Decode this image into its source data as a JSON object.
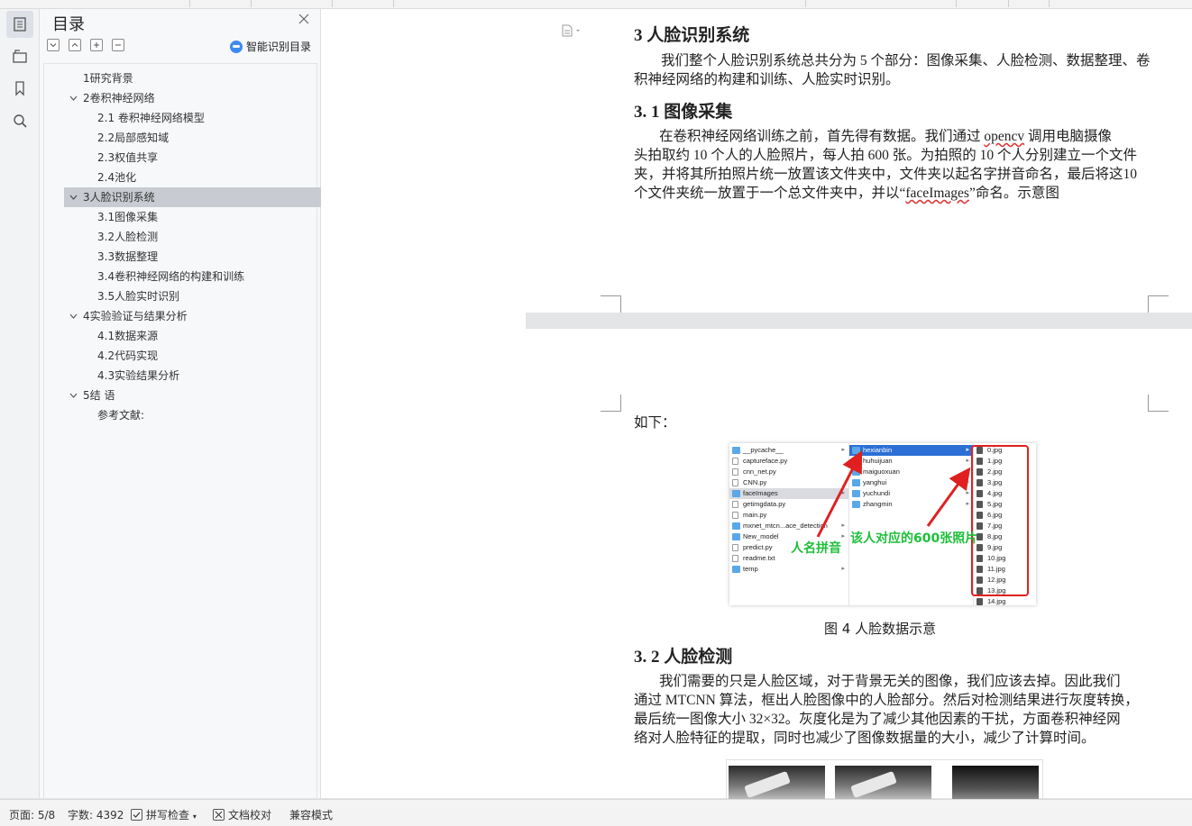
{
  "toc": {
    "title": "目录",
    "ai_button_label": "智能识别目录",
    "items": [
      {
        "label": "1研究背景"
      },
      {
        "label": "2卷积神经网络"
      },
      {
        "label": "2.1 卷积神经网络模型"
      },
      {
        "label": "2.2局部感知域"
      },
      {
        "label": "2.3权值共享"
      },
      {
        "label": "2.4池化"
      },
      {
        "label": "3人脸识别系统"
      },
      {
        "label": "3.1图像采集"
      },
      {
        "label": "3.2人脸检测"
      },
      {
        "label": "3.3数据整理"
      },
      {
        "label": "3.4卷积神经网络的构建和训练"
      },
      {
        "label": "3.5人脸实时识别"
      },
      {
        "label": "4实验验证与结果分析"
      },
      {
        "label": "4.1数据来源"
      },
      {
        "label": "4.2代码实现"
      },
      {
        "label": "4.3实验结果分析"
      },
      {
        "label": "5结  语"
      },
      {
        "label": "参考文献:"
      }
    ]
  },
  "document": {
    "h_3": "3  人脸识别系统",
    "p_3": [
      "我们整个人脸识别系统总共分为 5 个部分：图像采集、人脸检测、数据整理、卷",
      "积神经网络的构建和训练、人脸实时识别。"
    ],
    "h_31": "3. 1  图像采集",
    "p_31": {
      "l1a": "在卷积神经网络训练之前，首先得有数据。我们通过 ",
      "l1b": "opencv",
      "l1c": " 调用电脑摄像",
      "l2": "头拍取约 10 个人的人脸照片，每人拍 600 张。为拍照的 10 个人分别建立一个文件",
      "l3": "夹，并将其所拍照片统一放置该文件夹中，文件夹以起名字拼音命名，最后将这10",
      "l4a": "个文件夹统一放置于一个总文件夹中，并以“",
      "l4b": "faceImages",
      "l4c": "”命名。示意图"
    },
    "p_cont": "如下：",
    "figure": {
      "col1": [
        "__pycache__",
        "captureface.py",
        "cnn_net.py",
        "CNN.py",
        "faceImages",
        "getimgdata.py",
        "main.py",
        "mxnet_mtcn...ace_detection",
        "New_model",
        "predict.py",
        "readme.txt",
        "temp"
      ],
      "col2": [
        "hexianbin",
        "huhuijuan",
        "maiguoxuan",
        "yanghui",
        "yuchundi",
        "zhangmin"
      ],
      "col3": [
        "0.jpg",
        "1.jpg",
        "2.jpg",
        "3.jpg",
        "4.jpg",
        "5.jpg",
        "6.jpg",
        "7.jpg",
        "8.jpg",
        "9.jpg",
        "10.jpg",
        "11.jpg",
        "12.jpg",
        "13.jpg",
        "14.jpg"
      ],
      "anno_left": "人名拼音",
      "anno_right": "该人对应的600张照片",
      "caption": "图 4 人脸数据示意"
    },
    "h_32": "3. 2  人脸检测",
    "p_32": [
      "我们需要的只是人脸区域，对于背景无关的图像，我们应该去掉。因此我们",
      "通过 MTCNN 算法，框出人脸图像中的人脸部分。然后对检测结果进行灰度转换，",
      "最后统一图像大小 32×32。灰度化是为了减少其他因素的干扰，方面卷积神经网",
      "络对人脸特征的提取，同时也减少了图像数据量的大小，减少了计算时间。"
    ]
  },
  "status": {
    "page": "页面: 5/8",
    "words": "字数: 4392",
    "spell": "拼写检查",
    "proof": "文档校对",
    "compat": "兼容模式"
  },
  "colors": {
    "accent": "#3d8bef",
    "annotation_green": "#1dbf3a",
    "annotation_red": "#e02020",
    "selected_row": "#c8ccd2"
  }
}
